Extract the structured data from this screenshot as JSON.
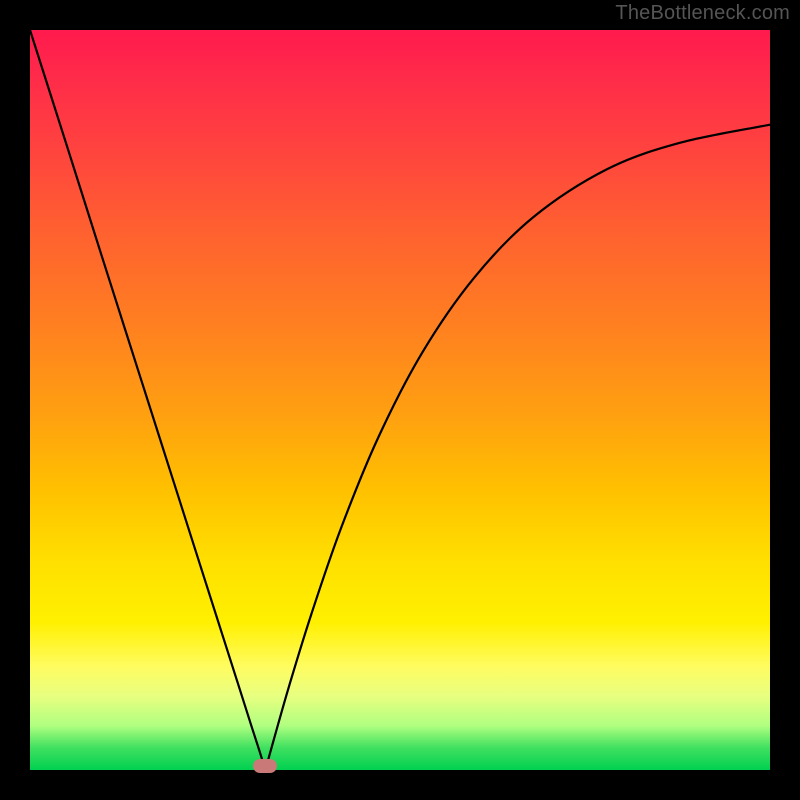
{
  "watermark": "TheBottleneck.com",
  "colors": {
    "frame_bg": "#000000",
    "curve_stroke": "#000000",
    "marker_fill": "#c97a78",
    "gradient_top": "#ff1a4d",
    "gradient_bottom": "#00d050"
  },
  "chart_data": {
    "type": "line",
    "title": "",
    "xlabel": "",
    "ylabel": "",
    "xlim": [
      0,
      100
    ],
    "ylim": [
      0,
      100
    ],
    "grid": false,
    "legend": false,
    "series": [
      {
        "name": "left-branch",
        "x": [
          0,
          5,
          10,
          15,
          20,
          25,
          28,
          30,
          31,
          31.8
        ],
        "values": [
          100,
          84.3,
          68.5,
          52.8,
          37.1,
          21.4,
          12.0,
          5.7,
          2.6,
          0.0
        ]
      },
      {
        "name": "right-branch",
        "x": [
          31.8,
          33,
          35,
          38,
          42,
          47,
          53,
          60,
          68,
          78,
          88,
          100
        ],
        "values": [
          0.0,
          4.3,
          11.3,
          21.0,
          32.6,
          44.8,
          56.4,
          66.5,
          74.7,
          81.2,
          84.8,
          87.2
        ]
      }
    ],
    "annotations": [
      {
        "name": "min-marker",
        "x": 31.8,
        "y": 0.6
      }
    ]
  }
}
